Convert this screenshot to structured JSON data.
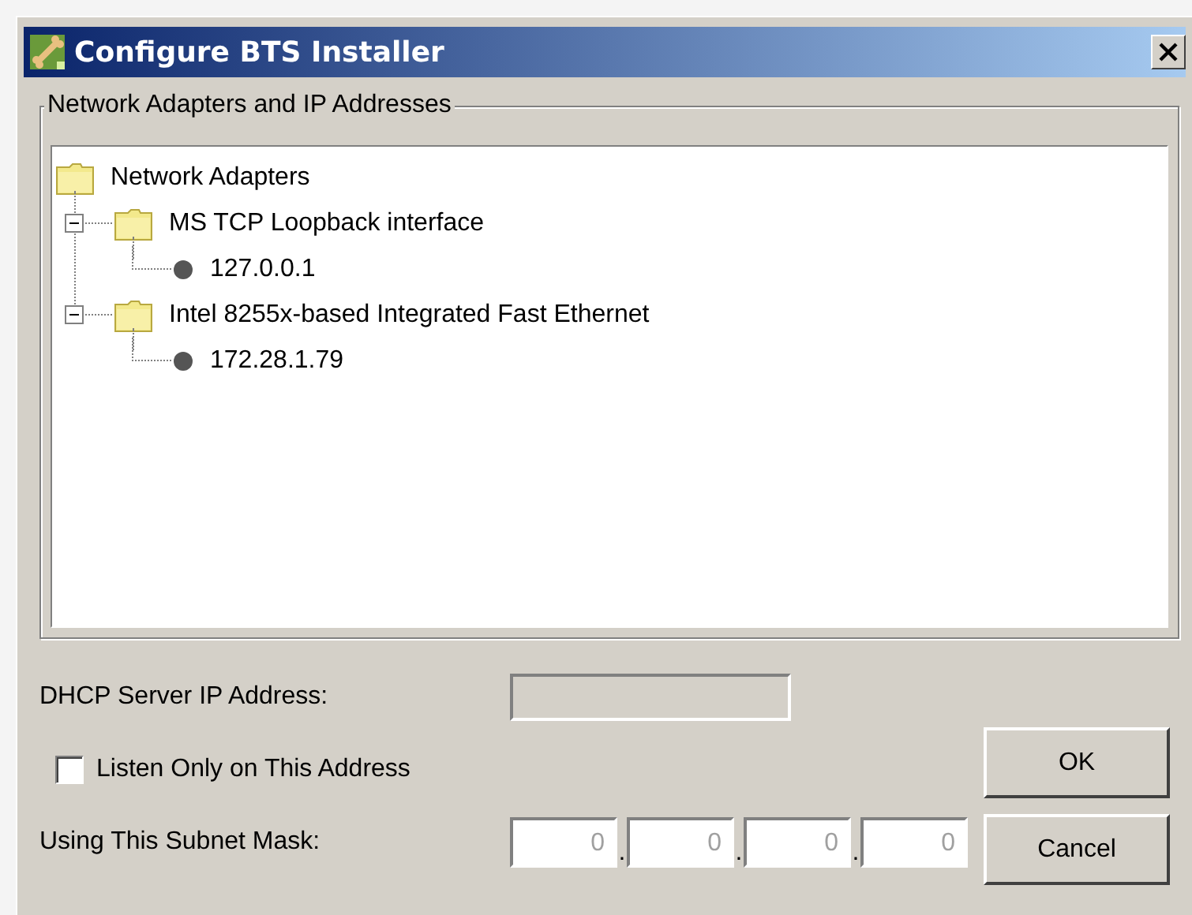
{
  "window": {
    "title": "Configure BTS Installer"
  },
  "group": {
    "title": "Network Adapters and IP Addresses"
  },
  "tree": [
    {
      "label": "Network Adapters",
      "kind": "folder",
      "children": [
        {
          "label": "MS TCP Loopback interface",
          "kind": "folder",
          "expanded": true,
          "children": [
            {
              "label": "127.0.0.1",
              "kind": "address"
            }
          ]
        },
        {
          "label": "Intel 8255x-based Integrated Fast Ethernet",
          "kind": "folder",
          "expanded": true,
          "children": [
            {
              "label": "172.28.1.79",
              "kind": "address"
            }
          ]
        }
      ]
    }
  ],
  "dhcp": {
    "label": "DHCP Server IP Address:",
    "disabled": true
  },
  "listen": {
    "label": "Listen Only on This Address",
    "checked": false
  },
  "subnet": {
    "label": "Using This Subnet Mask:",
    "disabled": true,
    "octets": [
      "0",
      "0",
      "0",
      "0"
    ],
    "separators": [
      ".",
      ".",
      "."
    ]
  },
  "buttons": [
    "OK",
    "Cancel"
  ]
}
